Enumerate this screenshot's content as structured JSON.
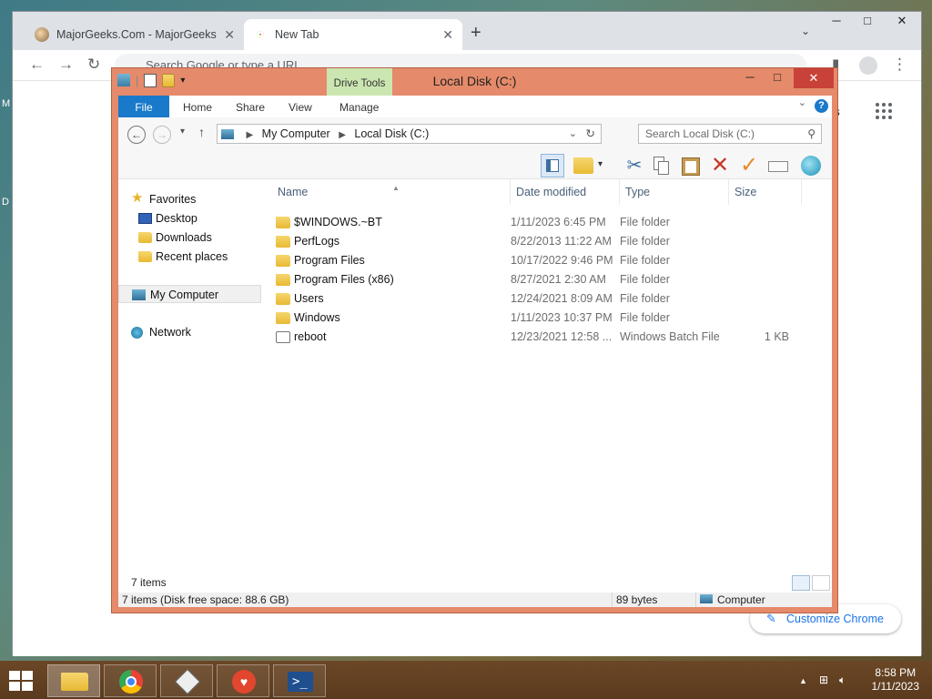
{
  "chrome": {
    "tabs": [
      {
        "title": "MajorGeeks.Com - MajorGeeks",
        "active": false,
        "close": "✕"
      },
      {
        "title": "New Tab",
        "active": true,
        "close": "✕"
      }
    ],
    "new_tab": "+",
    "omnibox_placeholder": "Search Google or type a URL",
    "apps_label": "es",
    "customize_label": "Customize Chrome",
    "colors": {
      "accent": "#1a73e8",
      "frame": "#dee1e6"
    }
  },
  "explorer": {
    "title": "Local Disk (C:)",
    "context_tab": "Drive Tools",
    "ribbon_tabs": [
      "File",
      "Home",
      "Share",
      "View",
      "Manage"
    ],
    "help": "?",
    "address": {
      "root": "My Computer",
      "current": "Local Disk (C:)"
    },
    "search_placeholder": "Search Local Disk (C:)",
    "nav": {
      "favorites": "Favorites",
      "favorite_items": [
        "Desktop",
        "Downloads",
        "Recent places"
      ],
      "computer": "My Computer",
      "network": "Network"
    },
    "columns": [
      "Name",
      "Date modified",
      "Type",
      "Size"
    ],
    "files": [
      {
        "name": "$WINDOWS.~BT",
        "date": "1/11/2023 6:45 PM",
        "type": "File folder",
        "size": "",
        "icon": "folder-icon"
      },
      {
        "name": "PerfLogs",
        "date": "8/22/2013 11:22 AM",
        "type": "File folder",
        "size": "",
        "icon": "folder-icon"
      },
      {
        "name": "Program Files",
        "date": "10/17/2022 9:46 PM",
        "type": "File folder",
        "size": "",
        "icon": "folder-icon"
      },
      {
        "name": "Program Files (x86)",
        "date": "8/27/2021 2:30 AM",
        "type": "File folder",
        "size": "",
        "icon": "folder-icon"
      },
      {
        "name": "Users",
        "date": "12/24/2021 8:09 AM",
        "type": "File folder",
        "size": "",
        "icon": "folder-icon"
      },
      {
        "name": "Windows",
        "date": "1/11/2023 10:37 PM",
        "type": "File folder",
        "size": "",
        "icon": "folder-icon"
      },
      {
        "name": "reboot",
        "date": "12/23/2021 12:58 ...",
        "type": "Windows Batch File",
        "size": "1 KB",
        "icon": "batch-file-icon"
      }
    ],
    "item_count": "7 items",
    "status": {
      "summary": "7 items (Disk free space: 88.6 GB)",
      "size": "89 bytes",
      "location": "Computer"
    },
    "colors": {
      "frame": "#e58a6a",
      "file_tab": "#1979ca",
      "context_tab": "#cce6b1",
      "close": "#c8423a"
    }
  },
  "taskbar": {
    "time": "8:58 PM",
    "date": "1/11/2023",
    "apps": [
      "file-explorer-icon",
      "chrome-icon",
      "sandbox-icon",
      "health-monitor-icon",
      "powershell-icon"
    ]
  },
  "desktop": {
    "edge_letters": [
      "M",
      "D"
    ]
  }
}
